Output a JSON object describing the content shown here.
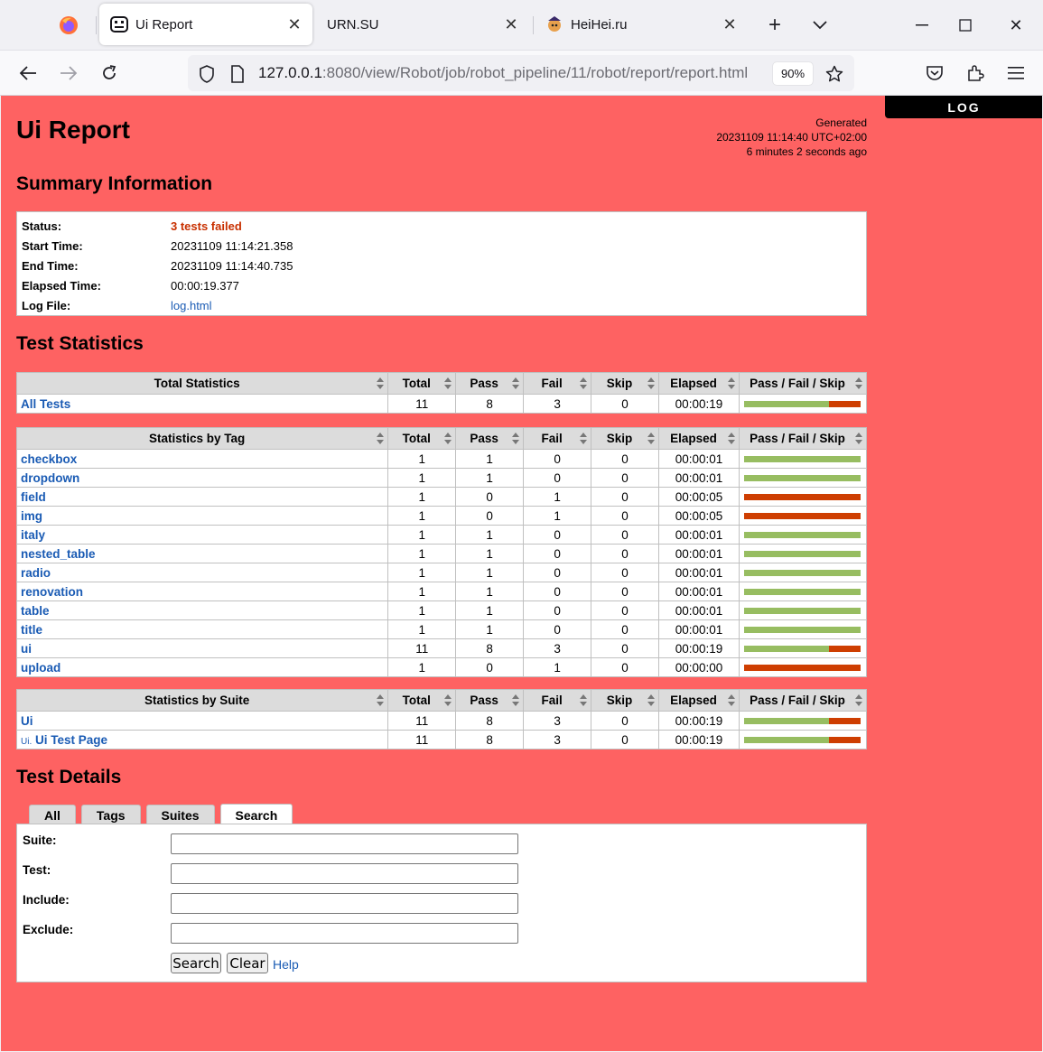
{
  "browser": {
    "tabs": [
      {
        "title": "Ui Report",
        "active": true
      },
      {
        "title": "URN.SU",
        "active": false
      },
      {
        "title": "HeiHei.ru",
        "active": false
      }
    ],
    "url_host": "127.0.0.1",
    "url_rest": ":8080/view/Robot/job/robot_pipeline/11/robot/report/report.html",
    "zoom": "90%"
  },
  "page": {
    "background": "#fe6262",
    "log_button": "LOG",
    "title": "Ui Report",
    "generated_label": "Generated",
    "generated_time": "20231109 11:14:40 UTC+02:00",
    "generated_ago": "6 minutes 2 seconds ago"
  },
  "summary": {
    "heading": "Summary Information",
    "rows": [
      {
        "label": "Status:",
        "value": "3 tests failed"
      },
      {
        "label": "Start Time:",
        "value": "20231109 11:14:21.358"
      },
      {
        "label": "End Time:",
        "value": "20231109 11:14:40.735"
      },
      {
        "label": "Elapsed Time:",
        "value": "00:00:19.377"
      },
      {
        "label": "Log File:",
        "value": "log.html"
      }
    ]
  },
  "statistics": {
    "heading": "Test Statistics",
    "columns": [
      "Total",
      "Pass",
      "Fail",
      "Skip",
      "Elapsed",
      "Pass / Fail / Skip"
    ],
    "total_title": "Total Statistics",
    "total_rows": [
      {
        "name": "All Tests",
        "total": "11",
        "pass": "8",
        "fail": "3",
        "skip": "0",
        "elapsed": "00:00:19"
      }
    ],
    "tag_title": "Statistics by Tag",
    "tag_rows": [
      {
        "name": "checkbox",
        "total": "1",
        "pass": "1",
        "fail": "0",
        "skip": "0",
        "elapsed": "00:00:01"
      },
      {
        "name": "dropdown",
        "total": "1",
        "pass": "1",
        "fail": "0",
        "skip": "0",
        "elapsed": "00:00:01"
      },
      {
        "name": "field",
        "total": "1",
        "pass": "0",
        "fail": "1",
        "skip": "0",
        "elapsed": "00:00:05"
      },
      {
        "name": "img",
        "total": "1",
        "pass": "0",
        "fail": "1",
        "skip": "0",
        "elapsed": "00:00:05"
      },
      {
        "name": "italy",
        "total": "1",
        "pass": "1",
        "fail": "0",
        "skip": "0",
        "elapsed": "00:00:01"
      },
      {
        "name": "nested_table",
        "total": "1",
        "pass": "1",
        "fail": "0",
        "skip": "0",
        "elapsed": "00:00:01"
      },
      {
        "name": "radio",
        "total": "1",
        "pass": "1",
        "fail": "0",
        "skip": "0",
        "elapsed": "00:00:01"
      },
      {
        "name": "renovation",
        "total": "1",
        "pass": "1",
        "fail": "0",
        "skip": "0",
        "elapsed": "00:00:01"
      },
      {
        "name": "table",
        "total": "1",
        "pass": "1",
        "fail": "0",
        "skip": "0",
        "elapsed": "00:00:01"
      },
      {
        "name": "title",
        "total": "1",
        "pass": "1",
        "fail": "0",
        "skip": "0",
        "elapsed": "00:00:01"
      },
      {
        "name": "ui",
        "total": "11",
        "pass": "8",
        "fail": "3",
        "skip": "0",
        "elapsed": "00:00:19"
      },
      {
        "name": "upload",
        "total": "1",
        "pass": "0",
        "fail": "1",
        "skip": "0",
        "elapsed": "00:00:00"
      }
    ],
    "suite_title": "Statistics by Suite",
    "suite_rows": [
      {
        "prefix": "",
        "name": "Ui",
        "total": "11",
        "pass": "8",
        "fail": "3",
        "skip": "0",
        "elapsed": "00:00:19"
      },
      {
        "prefix": "Ui.",
        "name": "Ui Test Page",
        "total": "11",
        "pass": "8",
        "fail": "3",
        "skip": "0",
        "elapsed": "00:00:19"
      }
    ]
  },
  "details": {
    "heading": "Test Details",
    "tabs": [
      "All",
      "Tags",
      "Suites",
      "Search"
    ],
    "active_tab": "Search",
    "fields": [
      {
        "label": "Suite:",
        "value": ""
      },
      {
        "label": "Test:",
        "value": ""
      },
      {
        "label": "Include:",
        "value": ""
      },
      {
        "label": "Exclude:",
        "value": ""
      }
    ],
    "search_button": "Search",
    "clear_button": "Clear",
    "help_link": "Help"
  },
  "colors": {
    "pass": "#97bd61",
    "fail": "#ce3e01",
    "link": "#1a5bb4"
  }
}
